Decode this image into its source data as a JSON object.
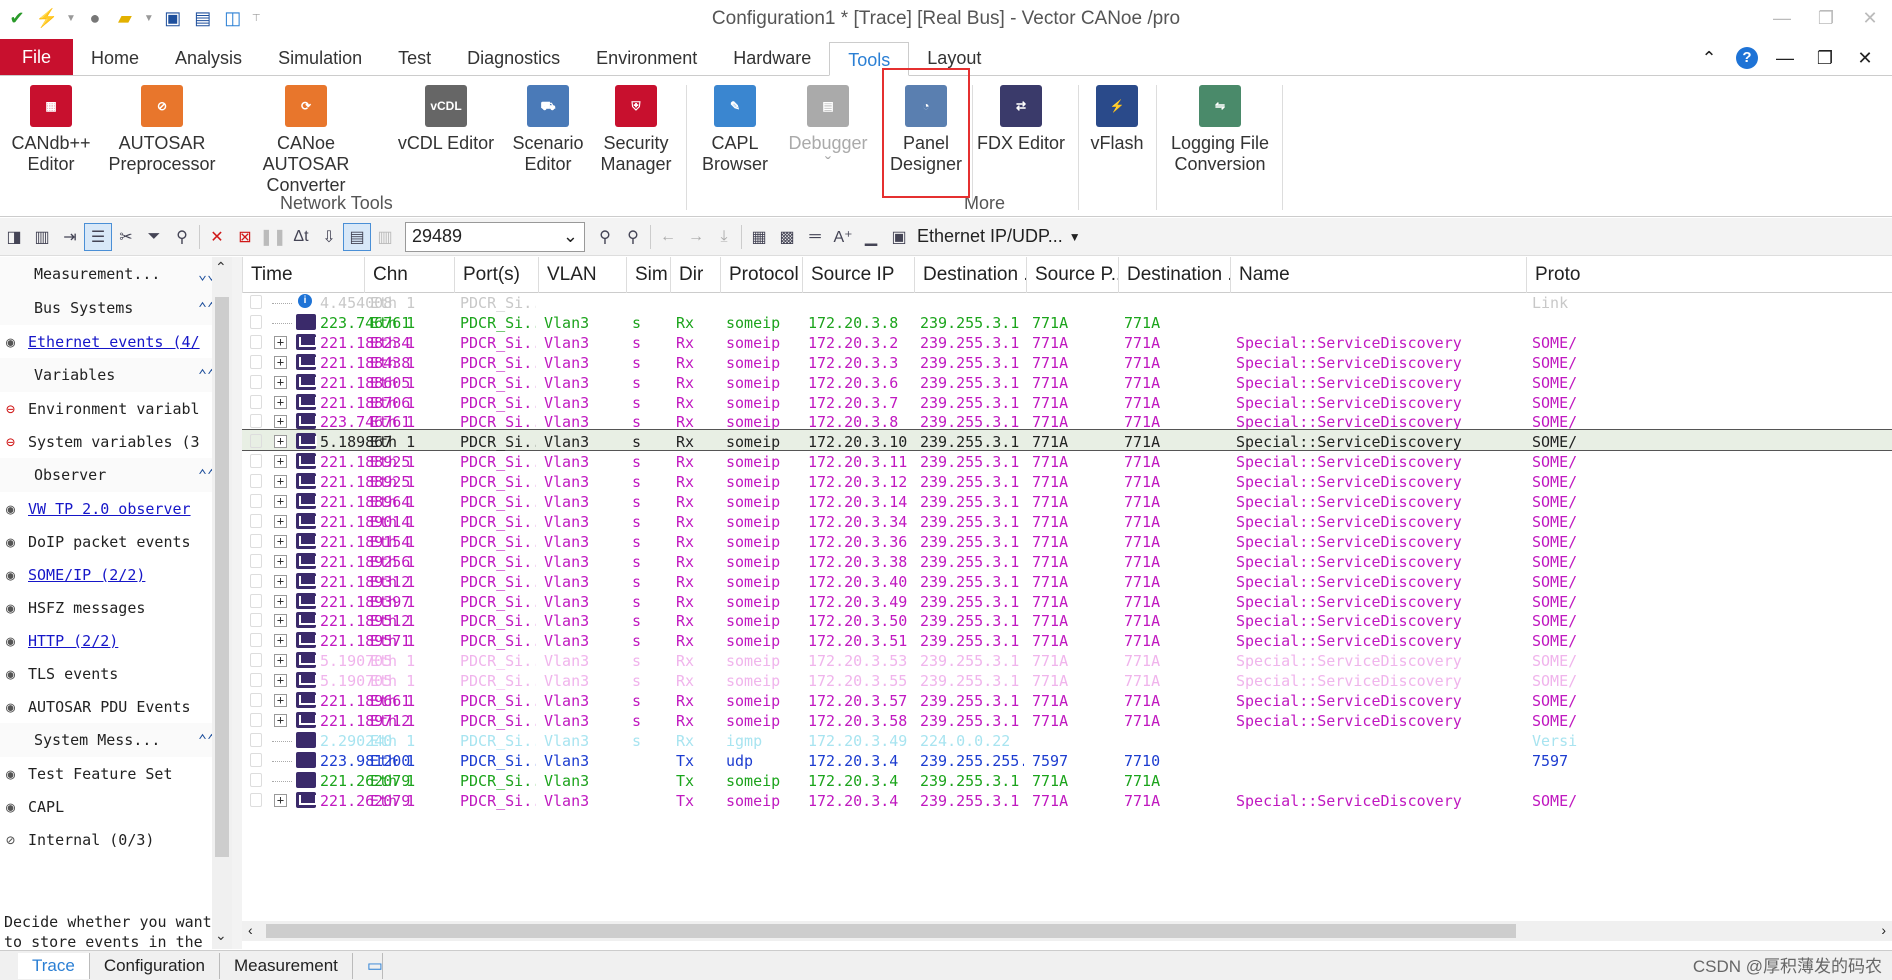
{
  "window": {
    "title": "Configuration1 * [Trace] [Real Bus] - Vector CANoe /pro",
    "controls": [
      "—",
      "❐",
      "✕"
    ]
  },
  "ribbon_tabs": [
    "File",
    "Home",
    "Analysis",
    "Simulation",
    "Test",
    "Diagnostics",
    "Environment",
    "Hardware",
    "Tools",
    "Layout"
  ],
  "active_tab": "Tools",
  "ribbon_groups": {
    "network_tools": {
      "label": "Network Tools",
      "buttons": [
        {
          "label1": "CANdb++",
          "label2": "Editor"
        },
        {
          "label1": "AUTOSAR",
          "label2": "Preprocessor"
        },
        {
          "label1": "CANoe AUTOSAR",
          "label2": "Converter"
        },
        {
          "label1": "vCDL Editor",
          "label2": ""
        },
        {
          "label1": "Scenario",
          "label2": "Editor"
        },
        {
          "label1": "Security",
          "label2": "Manager"
        }
      ]
    },
    "more": {
      "label": "More",
      "buttons": [
        {
          "label1": "CAPL",
          "label2": "Browser"
        },
        {
          "label1": "Debugger",
          "label2": "ˇ"
        },
        {
          "label1": "Panel",
          "label2": "Designer"
        },
        {
          "label1": "FDX Editor",
          "label2": ""
        },
        {
          "label1": "vFlash",
          "label2": ""
        },
        {
          "label1": "Logging File",
          "label2": "Conversion"
        }
      ]
    },
    "icon_text_vcdl": "vCDL"
  },
  "toolbar": {
    "filter_value": "29489",
    "protocol_selector": "Ethernet IP/UDP...",
    "dropdown_arrow": "⌄"
  },
  "left_pane": {
    "sections": [
      {
        "title": "Measurement...",
        "collapsed": true,
        "items": []
      },
      {
        "title": "Bus Systems",
        "items": [
          {
            "icon": "eye-icon",
            "glyph": "◉",
            "text": "Ethernet events (4/",
            "link": true
          }
        ]
      },
      {
        "title": "Variables",
        "items": [
          {
            "icon": "stop-icon",
            "glyph": "⊖",
            "text": "Environment variabl",
            "link": false
          },
          {
            "icon": "stop-icon",
            "glyph": "⊖",
            "text": "System variables (3",
            "link": false
          }
        ]
      },
      {
        "title": "Observer",
        "items": [
          {
            "icon": "eye-icon",
            "glyph": "◉",
            "text": "VW TP 2.0 observer ",
            "link": true
          },
          {
            "icon": "eye-icon",
            "glyph": "◉",
            "text": "DoIP packet events",
            "link": false
          },
          {
            "icon": "eye-icon",
            "glyph": "◉",
            "text": "SOME/IP (2/2)",
            "link": true
          },
          {
            "icon": "eye-icon",
            "glyph": "◉",
            "text": "HSFZ messages",
            "link": false
          },
          {
            "icon": "eye-icon",
            "glyph": "◉",
            "text": "HTTP (2/2)",
            "link": true
          },
          {
            "icon": "eye-icon",
            "glyph": "◉",
            "text": "TLS events",
            "link": false
          },
          {
            "icon": "eye-icon",
            "glyph": "◉",
            "text": "AUTOSAR PDU Events",
            "link": false
          }
        ]
      },
      {
        "title": "System Mess...",
        "items": [
          {
            "icon": "eye-icon",
            "glyph": "◉",
            "text": "Test Feature Set",
            "link": false
          },
          {
            "icon": "eye-icon",
            "glyph": "◉",
            "text": "CAPL",
            "link": false
          },
          {
            "icon": "eye-off-icon",
            "glyph": "⊘",
            "text": "Internal (0/3)",
            "link": false
          }
        ]
      }
    ],
    "description_line1": "Decide whether you want",
    "description_line2": "to store events in the",
    "chevron_down": "⌄⌄",
    "chevron_up": "⌃⌃"
  },
  "trace": {
    "columns": [
      "Time",
      "Chn",
      "Port(s)",
      "VLAN",
      "Sim",
      "Dir",
      "Protocol",
      "Source IP",
      "Destination ...",
      "Source P...",
      "Destination ...",
      "Name",
      "Proto"
    ],
    "rows": [
      {
        "kind": "info",
        "color": "#c8c8c8",
        "time": "4.454008",
        "chn": "Eth 1",
        "port": "PDCR_Si...",
        "vlan": "",
        "sim": "",
        "dir": "",
        "proto": "",
        "src": "",
        "dst": "",
        "sp": "",
        "dp": "",
        "name": "",
        "p2": "Link"
      },
      {
        "kind": "pkt",
        "color": "#1aa51a",
        "time": "223.746761",
        "chn": "Eth 1",
        "port": "PDCR_Si...",
        "vlan": "Vlan3",
        "sim": "s",
        "dir": "Rx",
        "proto": "someip",
        "src": "172.20.3.8",
        "dst": "239.255.3.1",
        "sp": "771A",
        "dp": "771A",
        "name": "",
        "p2": ""
      },
      {
        "kind": "msg",
        "color": "#c018c0",
        "time": "221.188234",
        "chn": "Eth 1",
        "port": "PDCR_Si...",
        "vlan": "Vlan3",
        "sim": "s",
        "dir": "Rx",
        "proto": "someip",
        "src": "172.20.3.2",
        "dst": "239.255.3.1",
        "sp": "771A",
        "dp": "771A",
        "name": "Special::ServiceDiscovery",
        "p2": "SOME/"
      },
      {
        "kind": "msg",
        "color": "#c018c0",
        "time": "221.188438",
        "chn": "Eth 1",
        "port": "PDCR_Si...",
        "vlan": "Vlan3",
        "sim": "s",
        "dir": "Rx",
        "proto": "someip",
        "src": "172.20.3.3",
        "dst": "239.255.3.1",
        "sp": "771A",
        "dp": "771A",
        "name": "Special::ServiceDiscovery",
        "p2": "SOME/"
      },
      {
        "kind": "msg",
        "color": "#c018c0",
        "time": "221.188605",
        "chn": "Eth 1",
        "port": "PDCR_Si...",
        "vlan": "Vlan3",
        "sim": "s",
        "dir": "Rx",
        "proto": "someip",
        "src": "172.20.3.6",
        "dst": "239.255.3.1",
        "sp": "771A",
        "dp": "771A",
        "name": "Special::ServiceDiscovery",
        "p2": "SOME/"
      },
      {
        "kind": "msg",
        "color": "#c018c0",
        "time": "221.188706",
        "chn": "Eth 1",
        "port": "PDCR_Si...",
        "vlan": "Vlan3",
        "sim": "s",
        "dir": "Rx",
        "proto": "someip",
        "src": "172.20.3.7",
        "dst": "239.255.3.1",
        "sp": "771A",
        "dp": "771A",
        "name": "Special::ServiceDiscovery",
        "p2": "SOME/"
      },
      {
        "kind": "msg",
        "color": "#c018c0",
        "time": "223.746761",
        "chn": "Eth 1",
        "port": "PDCR_Si...",
        "vlan": "Vlan3",
        "sim": "s",
        "dir": "Rx",
        "proto": "someip",
        "src": "172.20.3.8",
        "dst": "239.255.3.1",
        "sp": "771A",
        "dp": "771A",
        "name": "Special::ServiceDiscovery",
        "p2": "SOME/"
      },
      {
        "kind": "msg",
        "color": "#222222",
        "sel": true,
        "time": "5.189867",
        "chn": "Eth 1",
        "port": "PDCR_Si...",
        "vlan": "Vlan3",
        "sim": "s",
        "dir": "Rx",
        "proto": "someip",
        "src": "172.20.3.10",
        "dst": "239.255.3.1",
        "sp": "771A",
        "dp": "771A",
        "name": "Special::ServiceDiscovery",
        "p2": "SOME/"
      },
      {
        "kind": "msg",
        "color": "#c018c0",
        "time": "221.188925",
        "chn": "Eth 1",
        "port": "PDCR_Si...",
        "vlan": "Vlan3",
        "sim": "s",
        "dir": "Rx",
        "proto": "someip",
        "src": "172.20.3.11",
        "dst": "239.255.3.1",
        "sp": "771A",
        "dp": "771A",
        "name": "Special::ServiceDiscovery",
        "p2": "SOME/"
      },
      {
        "kind": "msg",
        "color": "#c018c0",
        "time": "221.188925",
        "chn": "Eth 1",
        "port": "PDCR_Si...",
        "vlan": "Vlan3",
        "sim": "s",
        "dir": "Rx",
        "proto": "someip",
        "src": "172.20.3.12",
        "dst": "239.255.3.1",
        "sp": "771A",
        "dp": "771A",
        "name": "Special::ServiceDiscovery",
        "p2": "SOME/"
      },
      {
        "kind": "msg",
        "color": "#c018c0",
        "time": "221.188964",
        "chn": "Eth 1",
        "port": "PDCR_Si...",
        "vlan": "Vlan3",
        "sim": "s",
        "dir": "Rx",
        "proto": "someip",
        "src": "172.20.3.14",
        "dst": "239.255.3.1",
        "sp": "771A",
        "dp": "771A",
        "name": "Special::ServiceDiscovery",
        "p2": "SOME/"
      },
      {
        "kind": "msg",
        "color": "#c018c0",
        "time": "221.189014",
        "chn": "Eth 1",
        "port": "PDCR_Si...",
        "vlan": "Vlan3",
        "sim": "s",
        "dir": "Rx",
        "proto": "someip",
        "src": "172.20.3.34",
        "dst": "239.255.3.1",
        "sp": "771A",
        "dp": "771A",
        "name": "Special::ServiceDiscovery",
        "p2": "SOME/"
      },
      {
        "kind": "msg",
        "color": "#c018c0",
        "time": "221.189154",
        "chn": "Eth 1",
        "port": "PDCR_Si...",
        "vlan": "Vlan3",
        "sim": "s",
        "dir": "Rx",
        "proto": "someip",
        "src": "172.20.3.36",
        "dst": "239.255.3.1",
        "sp": "771A",
        "dp": "771A",
        "name": "Special::ServiceDiscovery",
        "p2": "SOME/"
      },
      {
        "kind": "msg",
        "color": "#c018c0",
        "time": "221.189256",
        "chn": "Eth 1",
        "port": "PDCR_Si...",
        "vlan": "Vlan3",
        "sim": "s",
        "dir": "Rx",
        "proto": "someip",
        "src": "172.20.3.38",
        "dst": "239.255.3.1",
        "sp": "771A",
        "dp": "771A",
        "name": "Special::ServiceDiscovery",
        "p2": "SOME/"
      },
      {
        "kind": "msg",
        "color": "#c018c0",
        "time": "221.189312",
        "chn": "Eth 1",
        "port": "PDCR_Si...",
        "vlan": "Vlan3",
        "sim": "s",
        "dir": "Rx",
        "proto": "someip",
        "src": "172.20.3.40",
        "dst": "239.255.3.1",
        "sp": "771A",
        "dp": "771A",
        "name": "Special::ServiceDiscovery",
        "p2": "SOME/"
      },
      {
        "kind": "msg",
        "color": "#c018c0",
        "time": "221.189397",
        "chn": "Eth 1",
        "port": "PDCR_Si...",
        "vlan": "Vlan3",
        "sim": "s",
        "dir": "Rx",
        "proto": "someip",
        "src": "172.20.3.49",
        "dst": "239.255.3.1",
        "sp": "771A",
        "dp": "771A",
        "name": "Special::ServiceDiscovery",
        "p2": "SOME/"
      },
      {
        "kind": "msg",
        "color": "#c018c0",
        "time": "221.189512",
        "chn": "Eth 1",
        "port": "PDCR_Si...",
        "vlan": "Vlan3",
        "sim": "s",
        "dir": "Rx",
        "proto": "someip",
        "src": "172.20.3.50",
        "dst": "239.255.3.1",
        "sp": "771A",
        "dp": "771A",
        "name": "Special::ServiceDiscovery",
        "p2": "SOME/"
      },
      {
        "kind": "msg",
        "color": "#c018c0",
        "time": "221.189571",
        "chn": "Eth 1",
        "port": "PDCR_Si...",
        "vlan": "Vlan3",
        "sim": "s",
        "dir": "Rx",
        "proto": "someip",
        "src": "172.20.3.51",
        "dst": "239.255.3.1",
        "sp": "771A",
        "dp": "771A",
        "name": "Special::ServiceDiscovery",
        "p2": "SOME/"
      },
      {
        "kind": "msg",
        "color": "#f0b4ec",
        "time": "5.190705",
        "chn": "Eth 1",
        "port": "PDCR_Si...",
        "vlan": "Vlan3",
        "sim": "s",
        "dir": "Rx",
        "proto": "someip",
        "src": "172.20.3.53",
        "dst": "239.255.3.1",
        "sp": "771A",
        "dp": "771A",
        "name": "Special::ServiceDiscovery",
        "p2": "SOME/"
      },
      {
        "kind": "msg",
        "color": "#f0b4ec",
        "time": "5.190705",
        "chn": "Eth 1",
        "port": "PDCR_Si...",
        "vlan": "Vlan3",
        "sim": "s",
        "dir": "Rx",
        "proto": "someip",
        "src": "172.20.3.55",
        "dst": "239.255.3.1",
        "sp": "771A",
        "dp": "771A",
        "name": "Special::ServiceDiscovery",
        "p2": "SOME/"
      },
      {
        "kind": "msg",
        "color": "#c018c0",
        "time": "221.189661",
        "chn": "Eth 1",
        "port": "PDCR_Si...",
        "vlan": "Vlan3",
        "sim": "s",
        "dir": "Rx",
        "proto": "someip",
        "src": "172.20.3.57",
        "dst": "239.255.3.1",
        "sp": "771A",
        "dp": "771A",
        "name": "Special::ServiceDiscovery",
        "p2": "SOME/"
      },
      {
        "kind": "msg",
        "color": "#c018c0",
        "time": "221.189712",
        "chn": "Eth 1",
        "port": "PDCR_Si...",
        "vlan": "Vlan3",
        "sim": "s",
        "dir": "Rx",
        "proto": "someip",
        "src": "172.20.3.58",
        "dst": "239.255.3.1",
        "sp": "771A",
        "dp": "771A",
        "name": "Special::ServiceDiscovery",
        "p2": "SOME/"
      },
      {
        "kind": "pkt",
        "color": "#a8e4f0",
        "time": "2.290240",
        "chn": "Eth 1",
        "port": "PDCR_Si...",
        "vlan": "Vlan3",
        "sim": "s",
        "dir": "Rx",
        "proto": "igmp",
        "src": "172.20.3.49",
        "dst": "224.0.0.22",
        "sp": "",
        "dp": "",
        "name": "",
        "p2": "Versi"
      },
      {
        "kind": "pkt",
        "color": "#1c3cd0",
        "time": "223.981200",
        "chn": "Eth 1",
        "port": "PDCR_Si...",
        "vlan": "Vlan3",
        "sim": "",
        "dir": "Tx",
        "proto": "udp",
        "src": "172.20.3.4",
        "dst": "239.255.255.1",
        "sp": "7597",
        "dp": "7710",
        "name": "",
        "p2": "7597"
      },
      {
        "kind": "pkt",
        "color": "#1aa51a",
        "time": "221.262079",
        "chn": "Eth 1",
        "port": "PDCR_Si...",
        "vlan": "Vlan3",
        "sim": "",
        "dir": "Tx",
        "proto": "someip",
        "src": "172.20.3.4",
        "dst": "239.255.3.1",
        "sp": "771A",
        "dp": "771A",
        "name": "",
        "p2": ""
      },
      {
        "kind": "msg",
        "color": "#c018c0",
        "time": "221.262079",
        "chn": "Eth 1",
        "port": "PDCR_Si...",
        "vlan": "Vlan3",
        "sim": "",
        "dir": "Tx",
        "proto": "someip",
        "src": "172.20.3.4",
        "dst": "239.255.3.1",
        "sp": "771A",
        "dp": "771A",
        "name": "Special::ServiceDiscovery",
        "p2": "SOME/"
      }
    ]
  },
  "bottom_tabs": [
    "Trace",
    "Configuration",
    "Measurement"
  ],
  "active_bottom_tab": "Trace",
  "watermark": "CSDN @厚积薄发的码农"
}
